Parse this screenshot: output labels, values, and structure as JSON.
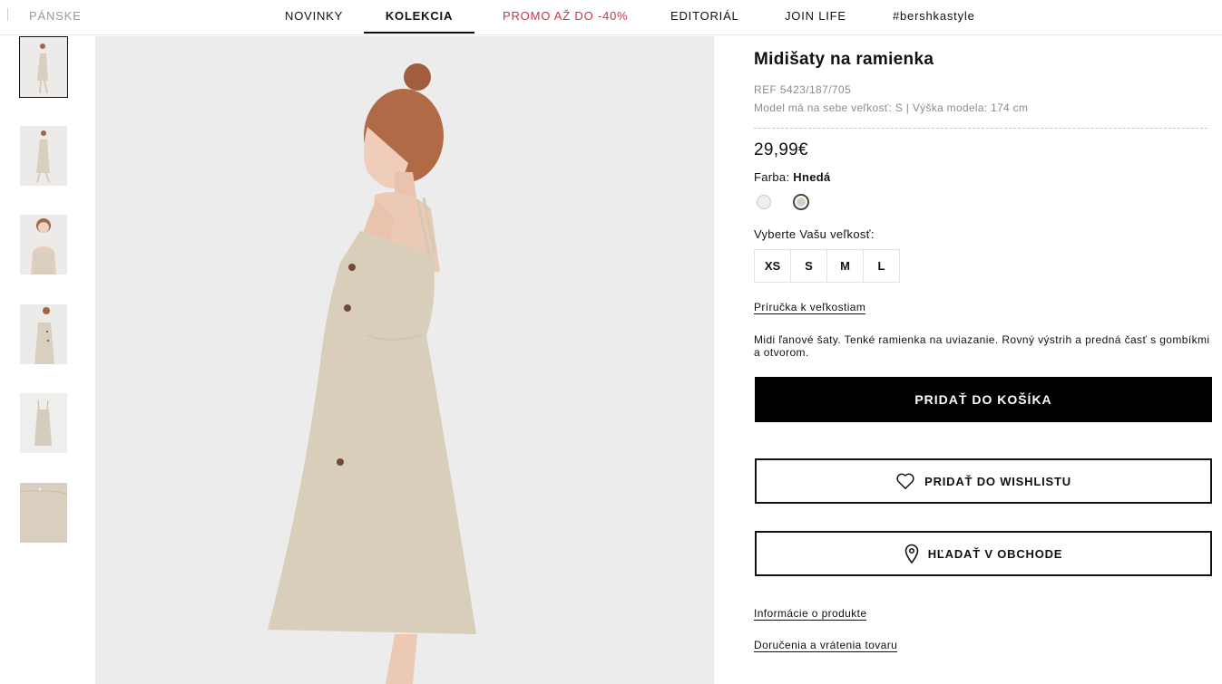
{
  "nav": {
    "men": "PÁNSKE",
    "items": [
      "NOVINKY",
      "KOLEKCIA",
      "PROMO AŽ DO -40%",
      "EDITORIÁL",
      "JOIN LIFE",
      "#bershkastyle"
    ],
    "active": "KOLEKCIA",
    "promo_color": "#d42f45"
  },
  "product": {
    "title": "Midišaty na ramienka",
    "ref": "REF 5423/187/705",
    "model_info": "Model má na sebe veľkosť: S | Výška modela: 174 cm",
    "price": "29,99€",
    "color_label": "Farba:",
    "color_value": "Hnedá",
    "swatches": [
      "#f1efea",
      "#d8d0c4"
    ],
    "size_label": "Vyberte Vašu veľkosť:",
    "sizes": [
      "XS",
      "S",
      "M",
      "L"
    ],
    "size_guide": "Príručka k veľkostiam",
    "description": "Midi ľanové šaty. Tenké ramienka na uviazanie. Rovný výstrih a predná časť s gombíkmi a otvorom.",
    "add_to_cart": "PRIDAŤ DO KOŠÍKA",
    "wishlist": "PRIDAŤ DO WISHLISTU",
    "find_store": "HĽADAŤ V OBCHODE",
    "product_info_link": "Informácie o produkte",
    "delivery_link": "Doručenia a vrátenia tovaru"
  },
  "icons": {
    "wishlist": "heart-icon",
    "store": "location-pin-icon"
  }
}
